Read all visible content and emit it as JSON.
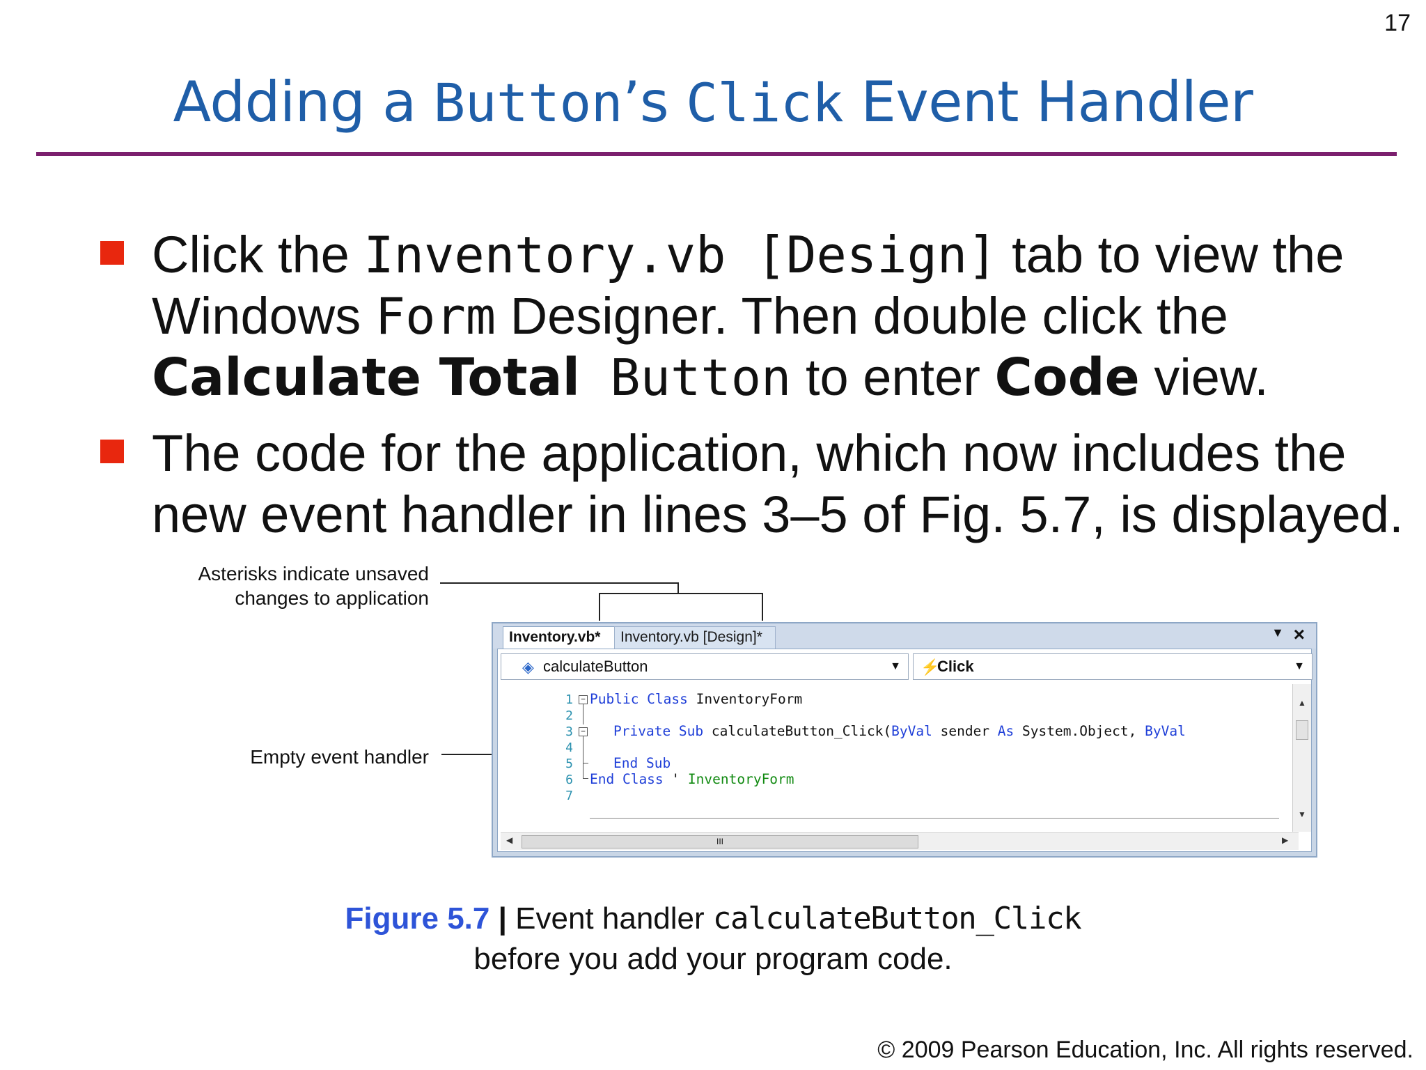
{
  "slide": {
    "number": "17",
    "title": {
      "part1": "Adding a ",
      "mono1": "Button",
      "part2": "’s ",
      "mono2": "Click",
      "part3": " Event Handler"
    }
  },
  "bullets": [
    {
      "line1": {
        "a": "Click the ",
        "code": "Inventory.vb [Design]",
        "b": " tab to view the"
      },
      "line2": {
        "a": "Windows ",
        "code": "Form",
        "b": " Designer. Then double click the"
      },
      "line3": {
        "bold1": "Calculate Total",
        "code": " Button",
        "a": " to enter ",
        "bold2": "Code",
        "b": " view."
      }
    },
    {
      "line1": "The code for the application, which now includes the",
      "line2": "new event handler in lines 3–5 of Fig. 5.7, is displayed."
    }
  ],
  "callouts": {
    "asterisks": [
      "Asterisks indicate unsaved",
      "changes to application"
    ],
    "empty_handler": "Empty event handler"
  },
  "ide": {
    "tabs": [
      "Inventory.vb*",
      "Inventory.vb [Design]*"
    ],
    "tab_menu_icon": "down-arrow",
    "close_icon": "×",
    "class_dropdown": "calculateButton",
    "method_dropdown": "Click",
    "line_numbers": [
      "1",
      "2",
      "3",
      "4",
      "5",
      "6",
      "7"
    ],
    "code": {
      "l1": {
        "kw": "Public Class",
        "rest": " InventoryForm"
      },
      "l3": {
        "kw1": "Private Sub",
        "mid": " calculateButton_Click(",
        "kw2": "ByVal",
        "mid2": " sender ",
        "kw3": "As",
        "mid3": " System.Object, ",
        "kw4": "ByVal"
      },
      "l5": {
        "kw": "End Sub"
      },
      "l6": {
        "kw": "End Class",
        "mid": " ' ",
        "comment": "InventoryForm"
      }
    },
    "hscroll_thumb_label": "III"
  },
  "caption": {
    "figure": "Figure 5.7",
    "sep": " | ",
    "text": "Event handler ",
    "code": "calculateButton_Click",
    "line2": "before you add your program code."
  },
  "footer": "© 2009 Pearson Education, Inc.  All rights reserved.",
  "colors": {
    "title": "#1f5ea8",
    "rule": "#7b1f6e",
    "bullet": "#e8270e",
    "figure_label": "#2e54d8",
    "keyword": "#1f3fd8",
    "comment": "#118a11"
  }
}
